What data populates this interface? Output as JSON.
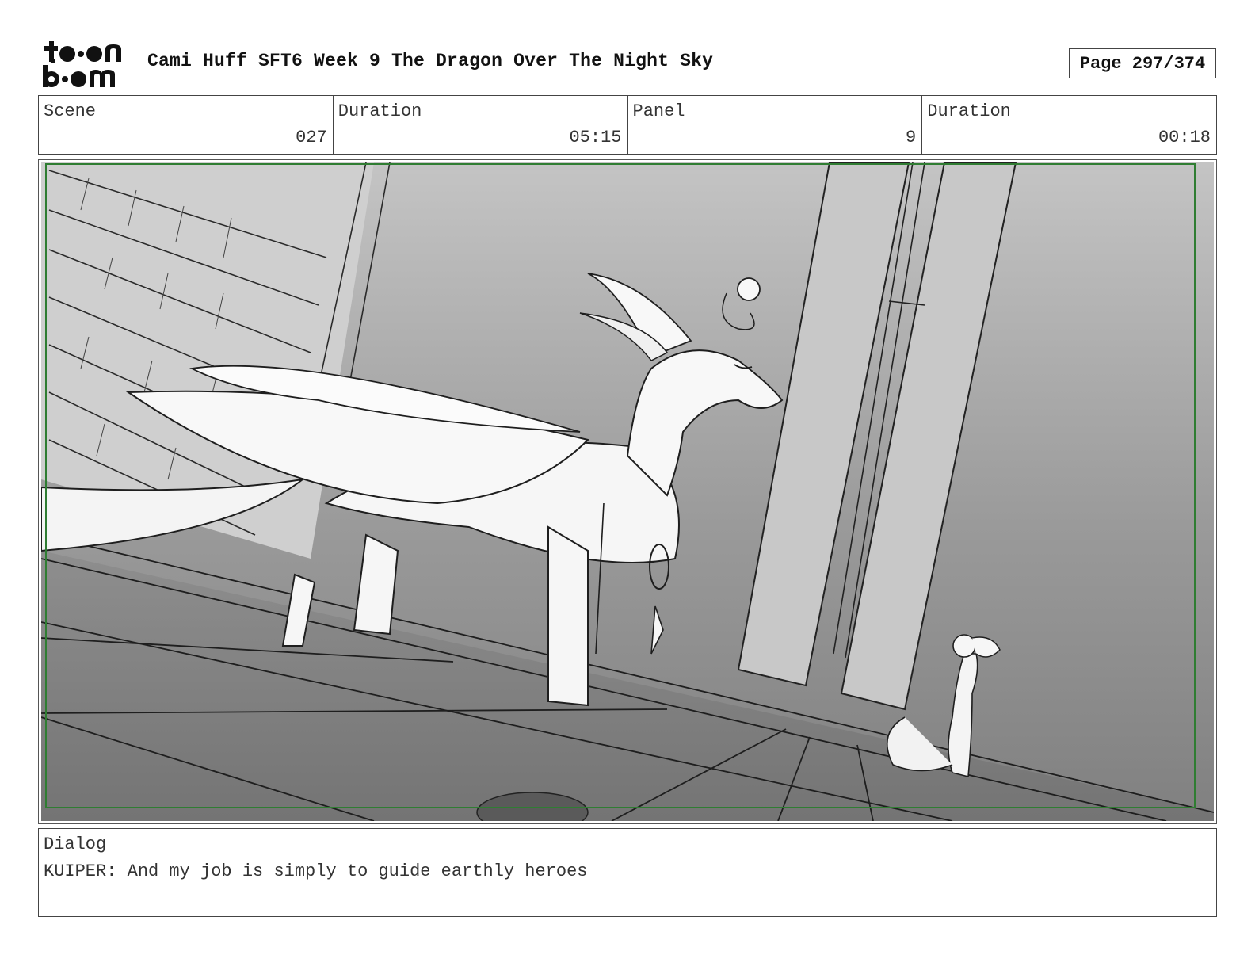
{
  "header": {
    "logo_text_top": "toon",
    "logo_text_bottom": "boom",
    "title": "Cami Huff SFT6 Week 9 The Dragon Over The Night Sky",
    "page": "Page 297/374"
  },
  "info": {
    "scene_label": "Scene",
    "scene_value": "027",
    "duration_label": "Duration",
    "duration_value": "05:15",
    "panel_label": "Panel",
    "panel_value": "9",
    "panel_duration_label": "Duration",
    "panel_duration_value": "00:18"
  },
  "dialog": {
    "label": "Dialog",
    "text": "KUIPER: And my job is simply to guide earthly heroes"
  },
  "colors": {
    "safe_frame": "#2f7d32",
    "sky_top": "#bdbdbd",
    "sky_bottom": "#8a8a8a",
    "ink": "#1e1e1e"
  }
}
